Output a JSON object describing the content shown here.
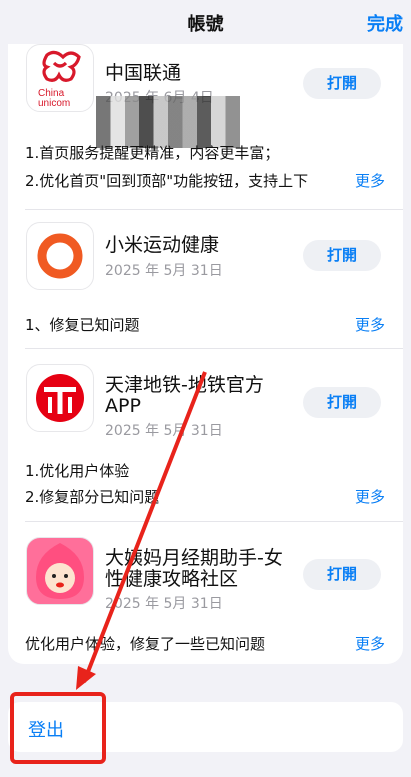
{
  "header": {
    "title": "帳號",
    "done_label": "完成"
  },
  "apps": [
    {
      "name": "中国联通",
      "date": "2025 年 6月 4日",
      "open_label": "打開",
      "notes": [
        "1.首页服务提醒更精准，内容更丰富；",
        "2.优化首页\"回到顶部\"功能按钮，支持上下"
      ],
      "more_label": "更多",
      "icon": "china-unicom-logo",
      "logo_text": [
        "China",
        "unicom"
      ]
    },
    {
      "name": "小米运动健康",
      "date": "2025 年 5月 31日",
      "open_label": "打開",
      "notes": [
        "1、修复已知问题"
      ],
      "more_label": "更多",
      "icon": "mi-fitness-ring-icon"
    },
    {
      "name_lines": [
        "天津地铁-地铁官方",
        "APP"
      ],
      "date": "2025 年 5月 31日",
      "open_label": "打開",
      "notes": [
        "1.优化用户体验",
        "2.修复部分已知问题"
      ],
      "more_label": "更多",
      "icon": "tianjin-metro-logo"
    },
    {
      "name_lines": [
        "大姨妈月经期助手-女",
        "性健康攻略社区"
      ],
      "date": "2025 年 5月 31日",
      "open_label": "打開",
      "notes": [
        "优化用户体验，修复了一些已知问题"
      ],
      "more_label": "更多",
      "icon": "period-assistant-face-icon"
    }
  ],
  "logout": {
    "label": "登出"
  },
  "annotation_color": "#e8231b",
  "accent_color": "#0a7ff5"
}
